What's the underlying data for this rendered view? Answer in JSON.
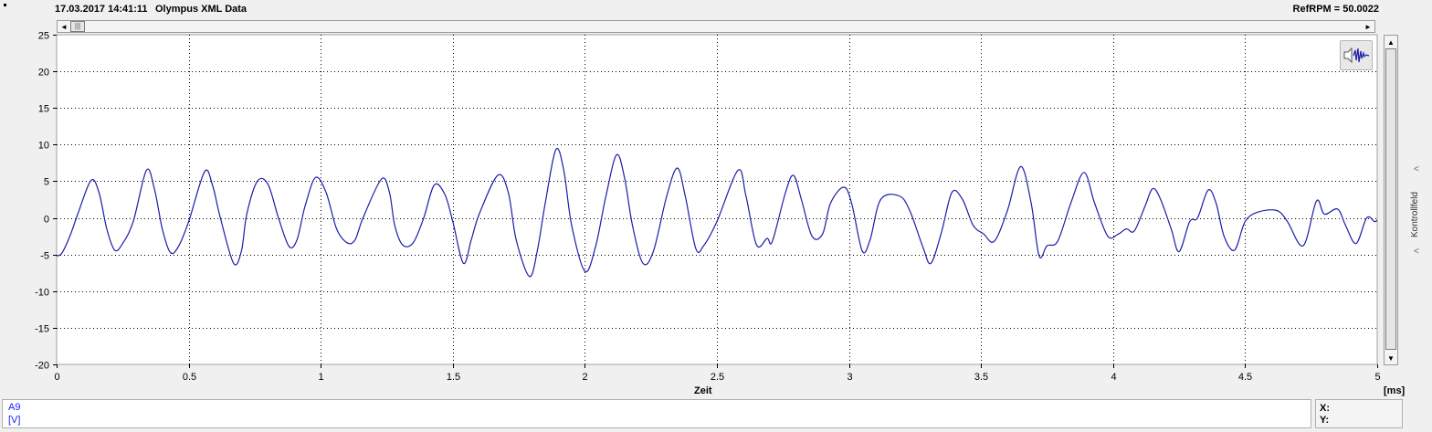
{
  "header": {
    "date": "17.03.2017 14:41:11",
    "title": "Olympus XML Data",
    "ref_rpm": "RefRPM = 50.0022"
  },
  "scrollbar": {
    "left_arrow": "◄",
    "right_arrow": "►",
    "thumb_grip": "|||",
    "up_arrow": "▲",
    "down_arrow": "▼"
  },
  "side_panel": {
    "label": "Kontrollfeld",
    "arrow": "<"
  },
  "channel": {
    "name": "A9",
    "unit": "[V]"
  },
  "cursor": {
    "x_label": "X:",
    "y_label": "Y:"
  },
  "colors": {
    "signal": "#1c1ca8",
    "grid": "#000000",
    "channel_text": "#1a1aff"
  },
  "icons": {
    "sound": "speaker-waveform-icon"
  },
  "chart_data": {
    "type": "line",
    "xlabel": "Zeit",
    "xunit": "[ms]",
    "xlim": [
      0,
      5
    ],
    "ylim": [
      -20,
      25
    ],
    "xticks": [
      "0",
      "0.5",
      "1",
      "1.5",
      "2",
      "2.5",
      "3",
      "3.5",
      "4",
      "4.5",
      "5"
    ],
    "yticks": [
      "25",
      "20",
      "15",
      "10",
      "5",
      "0",
      "-5",
      "-10",
      "-15",
      "-20"
    ],
    "grid": true,
    "series": [
      {
        "values": [
          [
            0.0,
            -5.2
          ],
          [
            0.02,
            -4.8
          ],
          [
            0.05,
            -2.5
          ],
          [
            0.08,
            0.5
          ],
          [
            0.13,
            5.1
          ],
          [
            0.16,
            3.5
          ],
          [
            0.19,
            -1.5
          ],
          [
            0.22,
            -4.4
          ],
          [
            0.25,
            -3.5
          ],
          [
            0.29,
            -0.5
          ],
          [
            0.34,
            6.5
          ],
          [
            0.37,
            4.0
          ],
          [
            0.4,
            -1.5
          ],
          [
            0.43,
            -4.7
          ],
          [
            0.46,
            -4.0
          ],
          [
            0.5,
            -0.5
          ],
          [
            0.56,
            6.3
          ],
          [
            0.59,
            4.5
          ],
          [
            0.62,
            0.0
          ],
          [
            0.67,
            -6.2
          ],
          [
            0.7,
            -4.5
          ],
          [
            0.72,
            0.5
          ],
          [
            0.76,
            5.0
          ],
          [
            0.8,
            4.6
          ],
          [
            0.84,
            0.0
          ],
          [
            0.88,
            -3.9
          ],
          [
            0.91,
            -3.0
          ],
          [
            0.94,
            1.5
          ],
          [
            0.98,
            5.5
          ],
          [
            1.02,
            3.5
          ],
          [
            1.06,
            -1.5
          ],
          [
            1.1,
            -3.4
          ],
          [
            1.13,
            -3.0
          ],
          [
            1.16,
            0.0
          ],
          [
            1.23,
            5.3
          ],
          [
            1.26,
            3.5
          ],
          [
            1.28,
            -1.0
          ],
          [
            1.31,
            -3.7
          ],
          [
            1.35,
            -3.4
          ],
          [
            1.39,
            0.0
          ],
          [
            1.43,
            4.5
          ],
          [
            1.47,
            3.2
          ],
          [
            1.5,
            -0.5
          ],
          [
            1.54,
            -6.2
          ],
          [
            1.57,
            -3.0
          ],
          [
            1.6,
            0.5
          ],
          [
            1.67,
            5.8
          ],
          [
            1.71,
            3.5
          ],
          [
            1.74,
            -3.0
          ],
          [
            1.79,
            -8.0
          ],
          [
            1.82,
            -4.5
          ],
          [
            1.85,
            2.0
          ],
          [
            1.89,
            9.3
          ],
          [
            1.92,
            6.5
          ],
          [
            1.95,
            -1.0
          ],
          [
            2.0,
            -7.3
          ],
          [
            2.04,
            -4.0
          ],
          [
            2.08,
            3.0
          ],
          [
            2.12,
            8.6
          ],
          [
            2.15,
            5.5
          ],
          [
            2.18,
            -1.0
          ],
          [
            2.22,
            -6.2
          ],
          [
            2.26,
            -4.5
          ],
          [
            2.31,
            3.0
          ],
          [
            2.35,
            6.8
          ],
          [
            2.38,
            3.0
          ],
          [
            2.42,
            -4.2
          ],
          [
            2.45,
            -3.8
          ],
          [
            2.5,
            -0.5
          ],
          [
            2.58,
            6.5
          ],
          [
            2.61,
            3.0
          ],
          [
            2.65,
            -3.7
          ],
          [
            2.69,
            -2.8
          ],
          [
            2.71,
            -3.2
          ],
          [
            2.76,
            3.5
          ],
          [
            2.79,
            5.8
          ],
          [
            2.82,
            2.5
          ],
          [
            2.86,
            -2.5
          ],
          [
            2.9,
            -2.2
          ],
          [
            2.93,
            2.0
          ],
          [
            2.98,
            4.2
          ],
          [
            3.01,
            2.0
          ],
          [
            3.05,
            -4.5
          ],
          [
            3.08,
            -3.0
          ],
          [
            3.12,
            2.5
          ],
          [
            3.19,
            3.0
          ],
          [
            3.23,
            1.0
          ],
          [
            3.28,
            -4.0
          ],
          [
            3.31,
            -6.2
          ],
          [
            3.35,
            -2.0
          ],
          [
            3.39,
            3.5
          ],
          [
            3.43,
            2.5
          ],
          [
            3.47,
            -1.0
          ],
          [
            3.51,
            -2.2
          ],
          [
            3.55,
            -3.2
          ],
          [
            3.6,
            1.0
          ],
          [
            3.65,
            7.0
          ],
          [
            3.69,
            2.0
          ],
          [
            3.72,
            -5.2
          ],
          [
            3.75,
            -3.8
          ],
          [
            3.79,
            -3.2
          ],
          [
            3.84,
            2.0
          ],
          [
            3.89,
            6.2
          ],
          [
            3.93,
            2.0
          ],
          [
            3.98,
            -2.5
          ],
          [
            4.02,
            -2.2
          ],
          [
            4.05,
            -1.5
          ],
          [
            4.08,
            -1.8
          ],
          [
            4.12,
            1.5
          ],
          [
            4.15,
            4.0
          ],
          [
            4.18,
            2.5
          ],
          [
            4.22,
            -1.5
          ],
          [
            4.25,
            -4.6
          ],
          [
            4.29,
            -0.5
          ],
          [
            4.32,
            0.0
          ],
          [
            4.36,
            3.8
          ],
          [
            4.39,
            2.0
          ],
          [
            4.42,
            -2.5
          ],
          [
            4.46,
            -4.4
          ],
          [
            4.5,
            -0.5
          ],
          [
            4.55,
            0.8
          ],
          [
            4.62,
            1.0
          ],
          [
            4.66,
            -0.5
          ],
          [
            4.72,
            -3.8
          ],
          [
            4.77,
            2.3
          ],
          [
            4.8,
            0.5
          ],
          [
            4.85,
            1.2
          ],
          [
            4.88,
            -1.0
          ],
          [
            4.92,
            -3.5
          ],
          [
            4.96,
            0.0
          ],
          [
            4.99,
            -0.5
          ],
          [
            5.0,
            -0.3
          ]
        ]
      }
    ]
  }
}
